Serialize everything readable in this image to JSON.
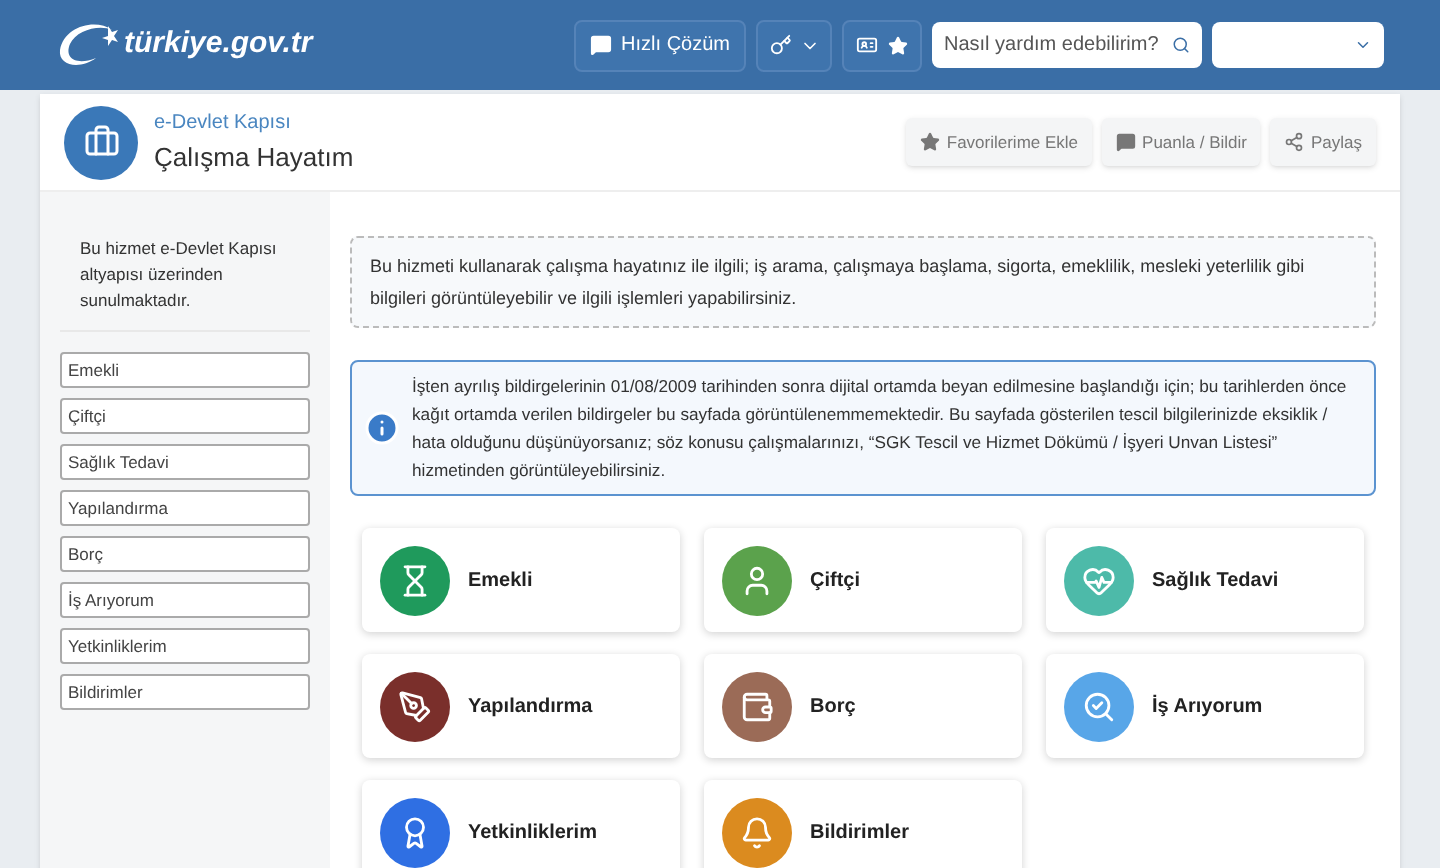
{
  "header": {
    "logo": "türkiye.gov.tr",
    "quick_button": "Hızlı Çözüm",
    "search": {
      "placeholder": "Nasıl yardım edebilirim?"
    }
  },
  "page": {
    "breadcrumb": "e-Devlet Kapısı",
    "title": "Çalışma Hayatım",
    "actions": [
      {
        "kind": "star",
        "label": "Favorilerime Ekle"
      },
      {
        "kind": "comment",
        "label": "Puanla / Bildir"
      },
      {
        "kind": "share",
        "label": "Paylaş"
      }
    ]
  },
  "sidebar": {
    "note": "Bu hizmet e-Devlet Kapısı altyapısı üzerinden sunulmaktadır.",
    "items": [
      "Emekli",
      "Çiftçi",
      "Sağlık Tedavi",
      "Yapılandırma",
      "Borç",
      "İş Arıyorum",
      "Yetkinliklerim",
      "Bildirimler"
    ]
  },
  "description": "Bu hizmeti kullanarak çalışma hayatınız ile ilgili; iş arama, çalışmaya başlama, sigorta, emeklilik, mesleki yeterlilik gibi bilgileri görüntüleyebilir ve ilgili işlemleri yapabilirsiniz.",
  "info": "İşten ayrılış bildirgelerinin 01/08/2009 tarihinden sonra dijital ortamda beyan edilmesine başlandığı için; bu tarihlerden önce kağıt ortamda verilen bildirgeler bu sayfada görüntülenemmemektedir. Bu sayfada gösterilen tescil bilgilerinizde eksiklik / hata olduğunu düşünüyorsanız; söz konusu çalışmalarınızı, “SGK Tescil ve Hizmet Dökümü / İşyeri Unvan Listesi” hizmetinden görüntüleyebilirsiniz.",
  "tiles": [
    {
      "kind": "retire",
      "label": "Emekli",
      "color": "#1f9a5c"
    },
    {
      "kind": "farmer",
      "label": "Çiftçi",
      "color": "#5ba24c"
    },
    {
      "kind": "health",
      "label": "Sağlık Tedavi",
      "color": "#4dbaa9"
    },
    {
      "kind": "tools",
      "label": "Yapılandırma",
      "color": "#7a2f2b"
    },
    {
      "kind": "wallet",
      "label": "Borç",
      "color": "#9b6b57"
    },
    {
      "kind": "jobsearch",
      "label": "İş Arıyorum",
      "color": "#58a6e8"
    },
    {
      "kind": "certificate",
      "label": "Yetkinliklerim",
      "color": "#2f6fe3"
    },
    {
      "kind": "bell",
      "label": "Bildirimler",
      "color": "#db8b1f"
    }
  ]
}
